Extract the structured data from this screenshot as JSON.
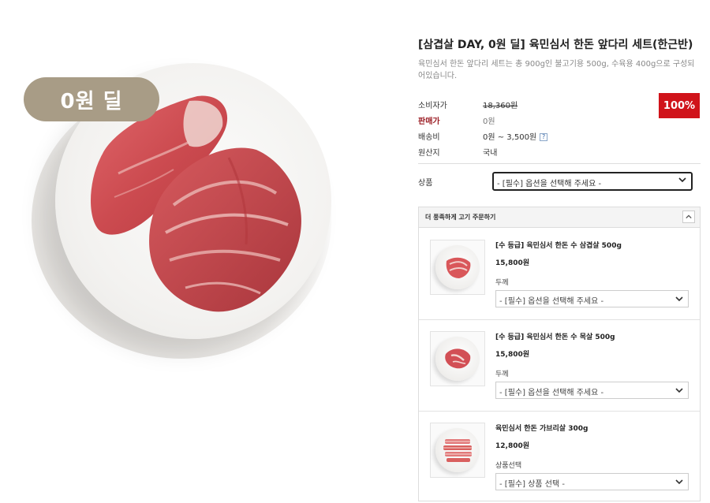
{
  "hero": {
    "badge": "0원 딜"
  },
  "product": {
    "title": "[삼겹살 DAY, 0원 딜] 육민심서 한돈 앞다리 세트(한근반)",
    "description": "육민심서 한돈 앞다리 세트는 총 900g인 불고기용 500g, 수육용 400g으로 구성되어있습니다.",
    "discount": "100%",
    "rows": [
      {
        "key": "소비자가",
        "value": "18,360원"
      },
      {
        "key": "판매가",
        "value": "0원"
      },
      {
        "key": "배송비",
        "value": "0원 ~ 3,500원"
      },
      {
        "key": "원산지",
        "value": "국내"
      }
    ],
    "shipping_help": "?",
    "option_label": "상품",
    "option_select": "- [필수] 옵션을 선택해 주세요 -"
  },
  "more": {
    "header": "더 풍족하게 고기 주문하기",
    "collapse_icon": "chevron-up",
    "items": [
      {
        "name": "[수 등급] 육민심서 한돈 수 삼겹살 500g",
        "price": "15,800원",
        "option_label": "두께",
        "select": "- [필수] 옵션을 선택해 주세요 -"
      },
      {
        "name": "[수 등급] 육민심서 한돈 수 목살 500g",
        "price": "15,800원",
        "option_label": "두께",
        "select": "- [필수] 옵션을 선택해 주세요 -"
      },
      {
        "name": "육민심서 한돈 가브리살 300g",
        "price": "12,800원",
        "option_label": "상품선택",
        "select": "- [필수] 상품 선택 -"
      }
    ]
  },
  "colors": {
    "badge": "#a89c86",
    "discount": "#d0131a",
    "sale_label": "#9b1d24",
    "meat": "#d9575a"
  }
}
